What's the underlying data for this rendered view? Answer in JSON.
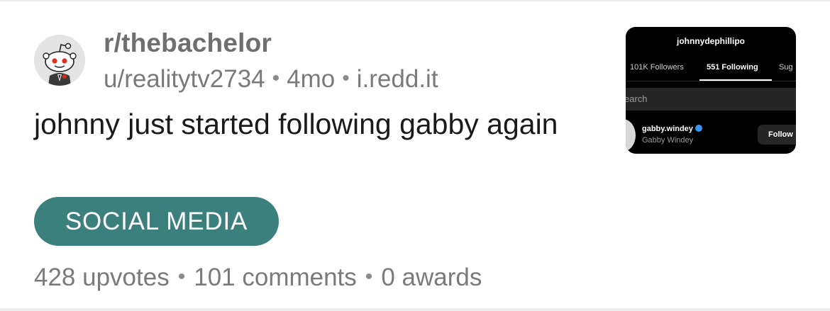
{
  "post": {
    "subreddit": "r/thebachelor",
    "author": "u/realitytv2734",
    "age": "4mo",
    "domain": "i.redd.it",
    "title": "johnny just started following gabby again",
    "flair": "SOCIAL MEDIA",
    "upvotes": "428 upvotes",
    "comments": "101 comments",
    "awards": "0 awards",
    "separator": "•"
  },
  "thumbnail": {
    "username": "johnnydephillipo",
    "tab_followers": "101K Followers",
    "tab_following": "551 Following",
    "tab_suggested": "Sug",
    "search_placeholder": "earch",
    "row_username": "gabby.windey",
    "row_name": "Gabby Windey",
    "row_button": "Follow"
  },
  "colors": {
    "flair_bg": "#3b807c",
    "meta_text": "#7a7a7a",
    "title_text": "#1a1a1a"
  },
  "icons": {
    "avatar": "snoo-avatar-icon",
    "verified": "verified-badge-icon"
  }
}
